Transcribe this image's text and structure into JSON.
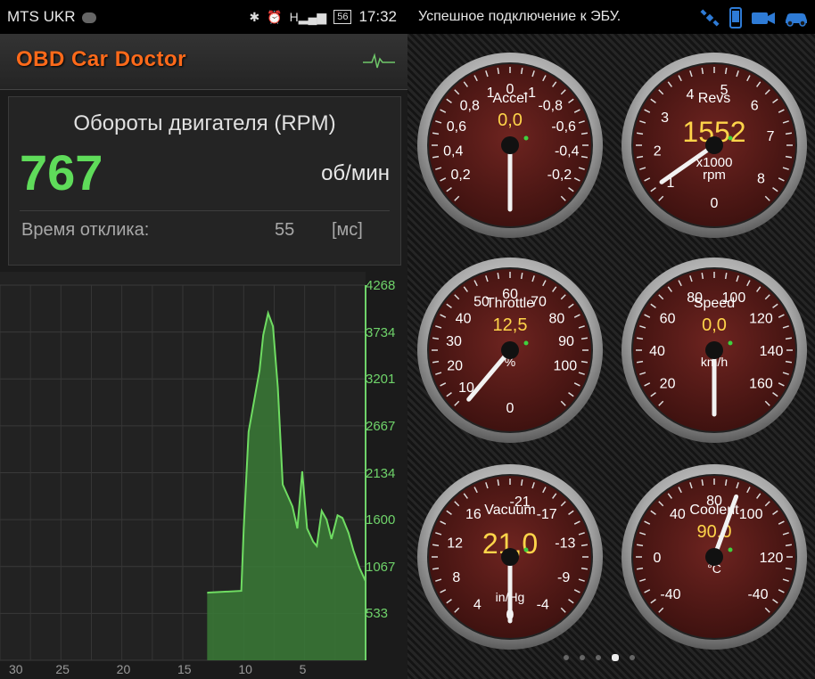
{
  "statusbar_left": {
    "carrier": "MTS UKR",
    "signal": "H",
    "battery": "56",
    "time": "17:32"
  },
  "app": {
    "title": "OBD Car Doctor"
  },
  "rpm_card": {
    "parameter_name": "Обороты двигателя (RPM)",
    "value": "767",
    "unit": "об/мин",
    "response_label": "Время отклика:",
    "response_value": "55",
    "response_unit": "[мс]"
  },
  "graph": {
    "y_ticks": [
      "4268",
      "3734",
      "3201",
      "2667",
      "2134",
      "1600",
      "1067",
      "533"
    ],
    "x_ticks": [
      "30",
      "25",
      "20",
      "15",
      "10",
      "5"
    ],
    "line_color": "#6fdc62",
    "fill_color": "#3a7a36",
    "ymax": 4268
  },
  "chart_data": {
    "type": "area",
    "x": [
      13.0,
      12.9,
      10.2,
      10.0,
      9.6,
      8.7,
      8.4,
      8.0,
      7.6,
      7.2,
      6.8,
      6.0,
      5.6,
      5.2,
      4.8,
      4.3,
      4.0,
      3.6,
      3.2,
      2.8,
      2.3,
      1.9,
      1.4,
      1.0,
      0.5,
      0.0
    ],
    "y": [
      767,
      770,
      790,
      1500,
      2600,
      3300,
      3700,
      3950,
      3800,
      3100,
      2000,
      1750,
      1500,
      2150,
      1500,
      1350,
      1300,
      1700,
      1600,
      1380,
      1650,
      1620,
      1450,
      1250,
      1050,
      900
    ],
    "xlim": [
      30,
      0
    ],
    "ylim": [
      0,
      4268
    ],
    "grid": true
  },
  "statusbar_right": {
    "connection_text": "Успешное подключение к ЭБУ."
  },
  "gauges": [
    {
      "label": "Accel",
      "value": "0,0",
      "ticks": [
        "0,2",
        "0,4",
        "0,6",
        "0,8",
        "1",
        "0",
        "-1",
        "-0,8",
        "-0,6",
        "-0,4",
        "-0,2"
      ]
    },
    {
      "label": "Revs",
      "value": "1552",
      "sublabel_1": "x1000",
      "sublabel_2": "rpm",
      "ticks": [
        "1",
        "2",
        "3",
        "4",
        "5",
        "6",
        "7",
        "8",
        "0"
      ]
    },
    {
      "label": "Throttle",
      "value": "12,5",
      "unit": "%",
      "ticks": [
        "10",
        "20",
        "30",
        "40",
        "50",
        "60",
        "70",
        "80",
        "90",
        "100",
        "0"
      ]
    },
    {
      "label": "Speed",
      "value": "0,0",
      "unit": "km/h",
      "ticks": [
        "20",
        "40",
        "60",
        "80",
        "100",
        "120",
        "140",
        "160"
      ]
    },
    {
      "label": "Vacuum",
      "value": "21,0",
      "unit": "in/Hg",
      "ticks": [
        "4",
        "8",
        "12",
        "16",
        "-21",
        "-17",
        "-13",
        "-9",
        "-4",
        "0"
      ]
    },
    {
      "label": "Coolent",
      "value": "90,0",
      "unit": "°C",
      "ticks": [
        "-40",
        "0",
        "40",
        "80",
        "100",
        "120",
        "-40"
      ]
    }
  ],
  "colors": {
    "face": "#5a1c18",
    "needle": "#f2f2f2",
    "rpm_green": "#5fdc5a",
    "title_orange": "#ff6a1a",
    "value_yellow": "#ffd54a"
  }
}
